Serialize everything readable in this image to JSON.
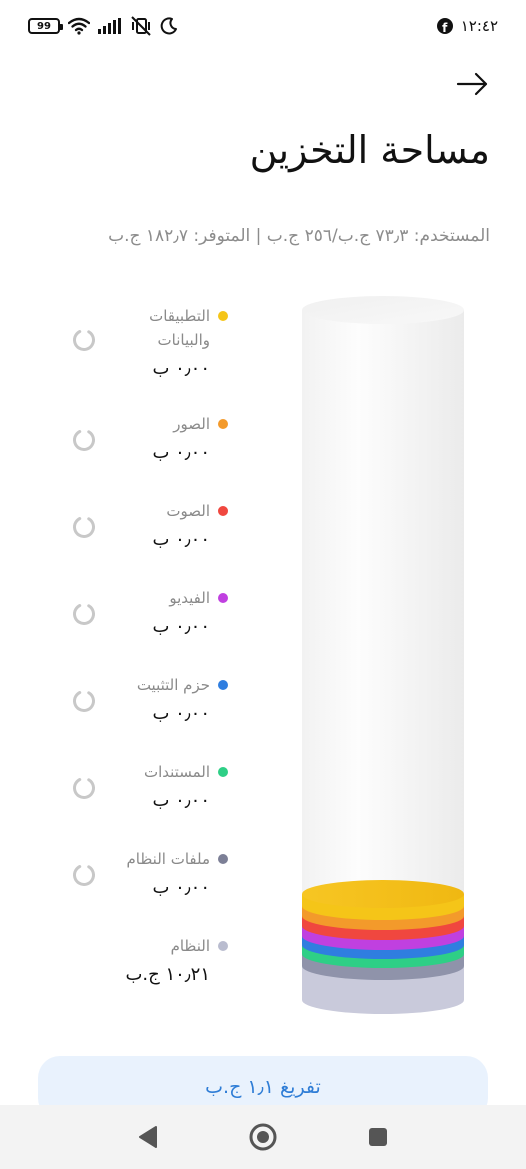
{
  "status_bar": {
    "battery": "99",
    "time": "١٢:٤٢",
    "left_icons": [
      "battery-icon",
      "wifi-icon",
      "signal-icon",
      "vibrate-off-icon",
      "moon-icon"
    ],
    "right_icons": [
      "facebook-icon"
    ]
  },
  "header": {
    "back_icon": "arrow-right-icon",
    "title": "مساحة التخزين",
    "summary": "المستخدم: ٧٣٫٣ ج.ب/٢٥٦ ج.ب | المتوفر: ١٨٢٫٧ ج.ب"
  },
  "categories": [
    {
      "label": "التطبيقات والبيانات",
      "size": "٠٫٠٠ ب",
      "color": "#f5c518",
      "loading": true
    },
    {
      "label": "الصور",
      "size": "٠٫٠٠ ب",
      "color": "#f39a2b",
      "loading": true
    },
    {
      "label": "الصوت",
      "size": "٠٫٠٠ ب",
      "color": "#f0473f",
      "loading": true
    },
    {
      "label": "الفيديو",
      "size": "٠٫٠٠ ب",
      "color": "#c040e0",
      "loading": true
    },
    {
      "label": "حزم التثبيت",
      "size": "٠٫٠٠ ب",
      "color": "#2f7ee0",
      "loading": true
    },
    {
      "label": "المستندات",
      "size": "٠٫٠٠ ب",
      "color": "#2ecf86",
      "loading": true
    },
    {
      "label": "ملفات النظام",
      "size": "٠٫٠٠ ب",
      "color": "#7c7f96",
      "loading": true
    },
    {
      "label": "النظام",
      "size": "١٠٫٢١ ج.ب",
      "color": "#b9bccf",
      "loading": false
    }
  ],
  "cylinder": {
    "layers_bottom_to_top": [
      "#c9cadb",
      "#8f93aa",
      "#2ecf86",
      "#2f7ee0",
      "#c040e0",
      "#f0473f",
      "#f39a2b",
      "#f5c518"
    ]
  },
  "actions": {
    "clean_label": "تفريغ ١٫١ ج.ب"
  },
  "nav_bar": {
    "icons": [
      "back-triangle-icon",
      "home-circle-icon",
      "recents-square-icon"
    ]
  }
}
